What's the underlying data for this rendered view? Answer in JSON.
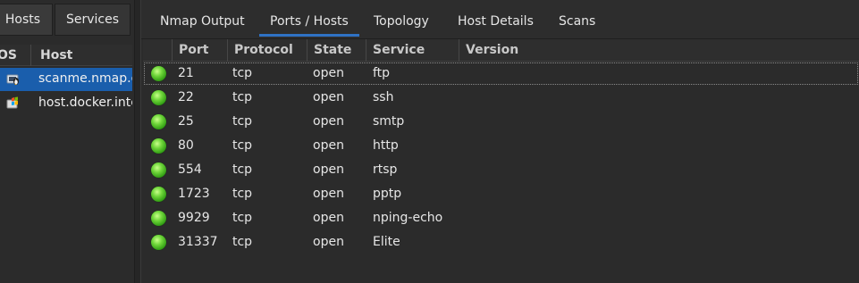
{
  "left_panel": {
    "tabs": [
      {
        "label": "Hosts",
        "active": true
      },
      {
        "label": "Services",
        "active": false
      }
    ],
    "columns": {
      "os": "OS",
      "host": "Host"
    },
    "hosts": [
      {
        "name": "scanme.nmap.org",
        "selected": true,
        "os_icon": "linux-penguin-icon"
      },
      {
        "name": "host.docker.internal",
        "selected": false,
        "os_icon": "windows-flag-icon"
      }
    ]
  },
  "main_tabs": [
    {
      "label": "Nmap Output",
      "active": false
    },
    {
      "label": "Ports / Hosts",
      "active": true
    },
    {
      "label": "Topology",
      "active": false
    },
    {
      "label": "Host Details",
      "active": false
    },
    {
      "label": "Scans",
      "active": false
    }
  ],
  "ports_table": {
    "columns": {
      "port": "Port",
      "protocol": "Protocol",
      "state": "State",
      "service": "Service",
      "version": "Version"
    },
    "status_color": "#5cc92e",
    "rows": [
      {
        "port": "21",
        "protocol": "tcp",
        "state": "open",
        "service": "ftp",
        "version": ""
      },
      {
        "port": "22",
        "protocol": "tcp",
        "state": "open",
        "service": "ssh",
        "version": ""
      },
      {
        "port": "25",
        "protocol": "tcp",
        "state": "open",
        "service": "smtp",
        "version": ""
      },
      {
        "port": "80",
        "protocol": "tcp",
        "state": "open",
        "service": "http",
        "version": ""
      },
      {
        "port": "554",
        "protocol": "tcp",
        "state": "open",
        "service": "rtsp",
        "version": ""
      },
      {
        "port": "1723",
        "protocol": "tcp",
        "state": "open",
        "service": "pptp",
        "version": ""
      },
      {
        "port": "9929",
        "protocol": "tcp",
        "state": "open",
        "service": "nping-echo",
        "version": ""
      },
      {
        "port": "31337",
        "protocol": "tcp",
        "state": "open",
        "service": "Elite",
        "version": ""
      }
    ]
  }
}
